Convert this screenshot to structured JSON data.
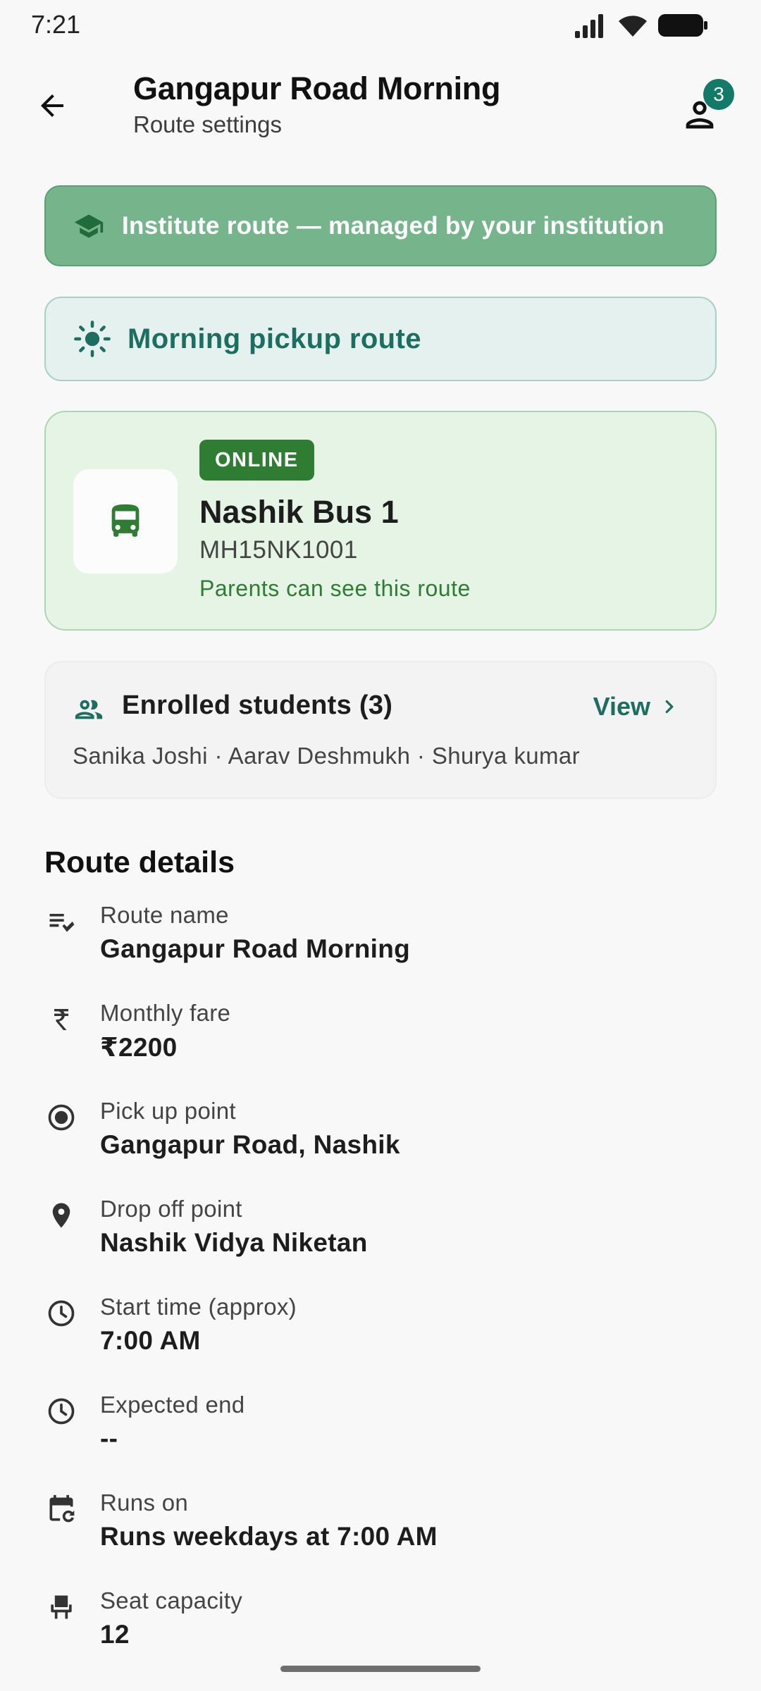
{
  "status_bar": {
    "time": "7:21"
  },
  "header": {
    "title": "Gangapur Road Morning",
    "subtitle": "Route settings",
    "people_count": "3"
  },
  "institute_banner": {
    "text": "Institute route — managed by your institution"
  },
  "morning_banner": {
    "text": "Morning pickup route"
  },
  "bus": {
    "status": "ONLINE",
    "name": "Nashik Bus 1",
    "plate": "MH15NK1001",
    "visibility": "Parents can see this route"
  },
  "students": {
    "title": "Enrolled students (3)",
    "view_label": "View",
    "names": "Sanika Joshi · Aarav Deshmukh · Shurya kumar"
  },
  "details": {
    "section_title": "Route details",
    "items": [
      {
        "icon": "edit-note-icon",
        "label": "Route name",
        "value": "Gangapur Road Morning"
      },
      {
        "icon": "rupee-icon",
        "label": "Monthly fare",
        "value": "₹2200"
      },
      {
        "icon": "radio-dot-icon",
        "label": "Pick up point",
        "value": "Gangapur Road, Nashik"
      },
      {
        "icon": "location-pin-icon",
        "label": "Drop off point",
        "value": "Nashik Vidya Niketan"
      },
      {
        "icon": "clock-icon",
        "label": "Start time (approx)",
        "value": "7:00 AM"
      },
      {
        "icon": "clock-icon",
        "label": "Expected end",
        "value": "--"
      },
      {
        "icon": "calendar-repeat-icon",
        "label": "Runs on",
        "value": "Runs weekdays at 7:00 AM"
      },
      {
        "icon": "seat-icon",
        "label": "Seat capacity",
        "value": "12"
      }
    ]
  },
  "colors": {
    "accent": "#1c6e60",
    "institute_banner_bg": "#76b58c",
    "online_green": "#2e7d32"
  }
}
